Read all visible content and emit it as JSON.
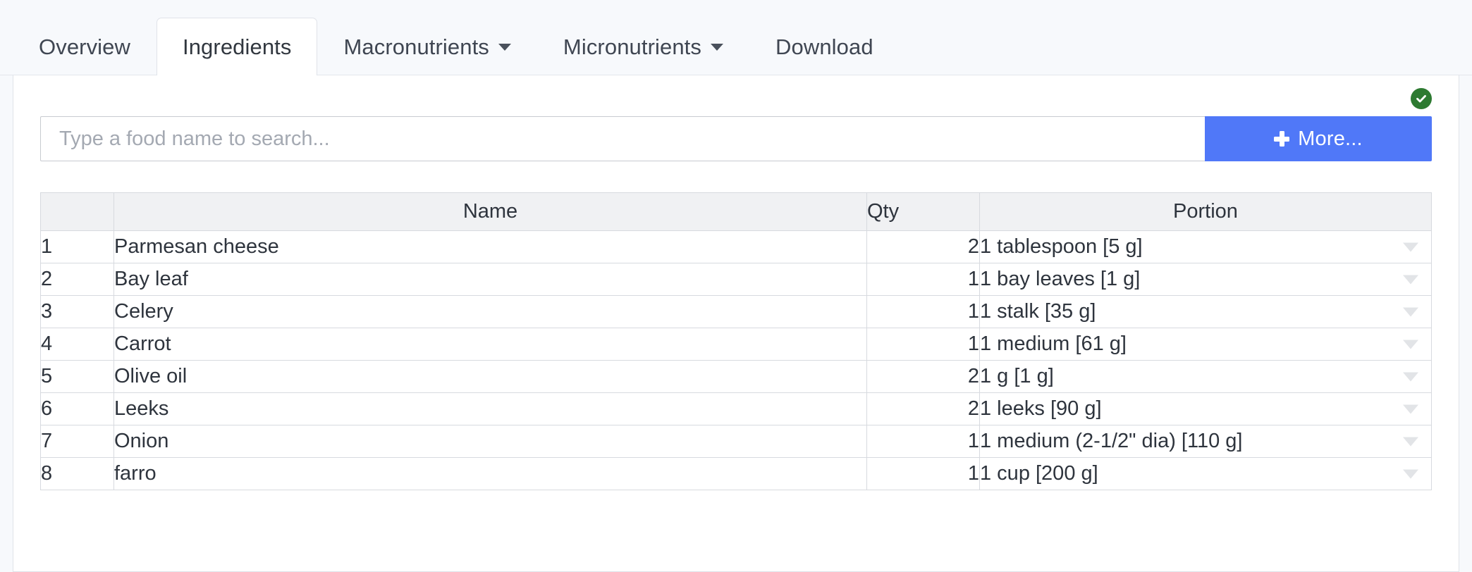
{
  "tabs": [
    {
      "label": "Overview",
      "active": false,
      "has_caret": false,
      "name": "tab-overview"
    },
    {
      "label": "Ingredients",
      "active": true,
      "has_caret": false,
      "name": "tab-ingredients"
    },
    {
      "label": "Macronutrients",
      "active": false,
      "has_caret": true,
      "name": "tab-macronutrients"
    },
    {
      "label": "Micronutrients",
      "active": false,
      "has_caret": true,
      "name": "tab-micronutrients"
    },
    {
      "label": "Download",
      "active": false,
      "has_caret": false,
      "name": "tab-download"
    }
  ],
  "status": {
    "icon": "check-circle-icon",
    "color": "#2d7a31"
  },
  "search": {
    "value": "",
    "placeholder": "Type a food name to search...",
    "button_label": "More...",
    "button_icon": "plus-icon",
    "button_color": "#5078f8"
  },
  "table": {
    "columns": [
      "",
      "Name",
      "Qty",
      "Portion"
    ],
    "rows": [
      {
        "idx": "1",
        "name": "Parmesan cheese",
        "qty": "2",
        "portion": "1 tablespoon [5 g]"
      },
      {
        "idx": "2",
        "name": "Bay leaf",
        "qty": "1",
        "portion": "1 bay leaves [1 g]"
      },
      {
        "idx": "3",
        "name": "Celery",
        "qty": "1",
        "portion": "1 stalk [35 g]"
      },
      {
        "idx": "4",
        "name": "Carrot",
        "qty": "1",
        "portion": "1 medium [61 g]"
      },
      {
        "idx": "5",
        "name": "Olive oil",
        "qty": "2",
        "portion": "1 g [1 g]"
      },
      {
        "idx": "6",
        "name": "Leeks",
        "qty": "2",
        "portion": "1 leeks [90 g]"
      },
      {
        "idx": "7",
        "name": "Onion",
        "qty": "1",
        "portion": "1 medium (2-1/2\" dia) [110 g]"
      },
      {
        "idx": "8",
        "name": "farro",
        "qty": "1",
        "portion": "1 cup [200 g]"
      }
    ]
  }
}
